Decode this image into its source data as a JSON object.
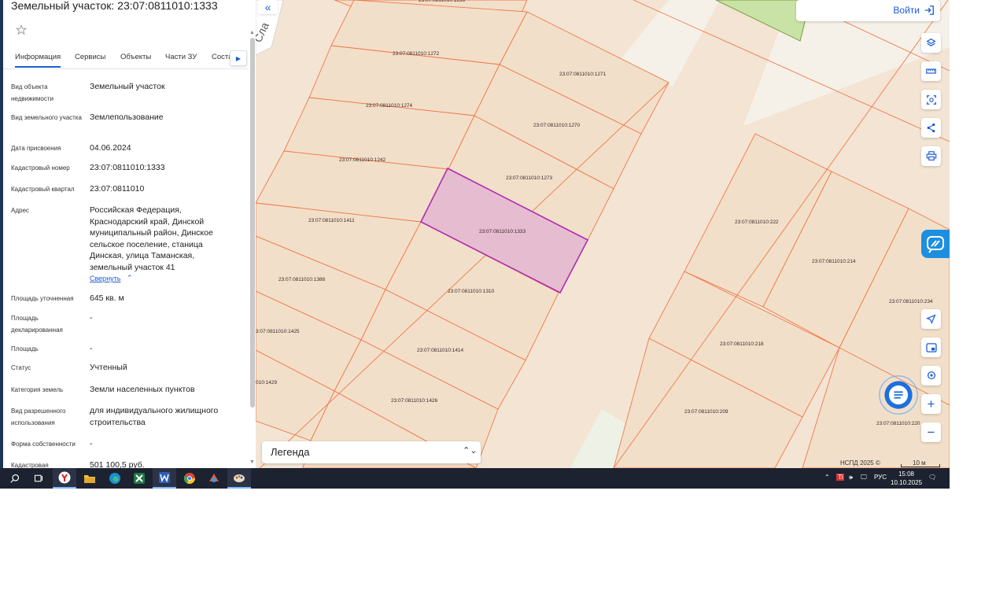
{
  "panel": {
    "title": "Земельный участок: 23:07:0811010:1333",
    "tabs": [
      "Информация",
      "Сервисы",
      "Объекты",
      "Части ЗУ",
      "Соста"
    ],
    "rows": [
      {
        "label": "Вид объекта недвижимости",
        "value": "Земельный участок"
      },
      {
        "label": "Вид земельного участка",
        "value": "Землепользование"
      },
      {
        "label": "Дата присвоения",
        "value": "04.06.2024"
      },
      {
        "label": "Кадастровый номер",
        "value": "23:07:0811010:1333"
      },
      {
        "label": "Кадастровый квартал",
        "value": "23:07:0811010"
      },
      {
        "label": "Адрес",
        "value": "Российская Федерация, Краснодарский край, Динской муниципальный район, Динское сельское поселение, станица Динская, улица Таманская, земельный участок 41"
      },
      {
        "label": "Площадь уточненная",
        "value": "645 кв. м"
      },
      {
        "label": "Площадь декларированная",
        "value": "-"
      },
      {
        "label": "Площадь",
        "value": "-"
      },
      {
        "label": "Статус",
        "value": "Учтенный"
      },
      {
        "label": "Категория земель",
        "value": "Земли населенных пунктов"
      },
      {
        "label": "Вид разрешенного использования",
        "value": "для индивидуального жилищного строительства"
      },
      {
        "label": "Форма собственности",
        "value": "-"
      },
      {
        "label": "Кадастровая",
        "value": "501 100,5 руб."
      }
    ],
    "collapse_label": "Свернуть"
  },
  "map": {
    "login_label": "Войти",
    "legend_label": "Легенда",
    "attribution": "НСПД 2025 ©",
    "scale_label": "10 м",
    "street_label": "Сла",
    "parcels": [
      {
        "id": "23:07:0811010:1236"
      },
      {
        "id": "23:07:0811010:1272"
      },
      {
        "id": "23:07:0811010:1271"
      },
      {
        "id": "23:07:0811010:1274"
      },
      {
        "id": "23:07:0811010:1270"
      },
      {
        "id": "23:07:0811010:1242"
      },
      {
        "id": "23:07:0811010:1273"
      },
      {
        "id": "23:07:0811010:1411"
      },
      {
        "id": "23:07:0811010:1333",
        "selected": true
      },
      {
        "id": "23:07:0811010:1388"
      },
      {
        "id": "23:07:0811010:1310"
      },
      {
        "id": "3:07:0811010:1425"
      },
      {
        "id": "23:07:0811010:1414"
      },
      {
        "id": "010:1429"
      },
      {
        "id": "23:07:0811010:1426"
      },
      {
        "id": "23:07:0811010:222"
      },
      {
        "id": "23:07:0811010:214"
      },
      {
        "id": "23:07:0811010:234"
      },
      {
        "id": "23:07:0811010:218"
      },
      {
        "id": "23:07:0811010:209"
      },
      {
        "id": "23:07:0811010:220"
      }
    ],
    "colors": {
      "parcel_fill": "#f2dfc9",
      "parcel_line": "#ef7a4a",
      "selected_fill": "#e6bcd0",
      "selected_line": "#b02db0",
      "green": "#c9e3a6",
      "accent": "#1c5bd6"
    }
  },
  "taskbar": {
    "time": "15:08",
    "date": "10.10.2025",
    "lang": "РУС"
  }
}
